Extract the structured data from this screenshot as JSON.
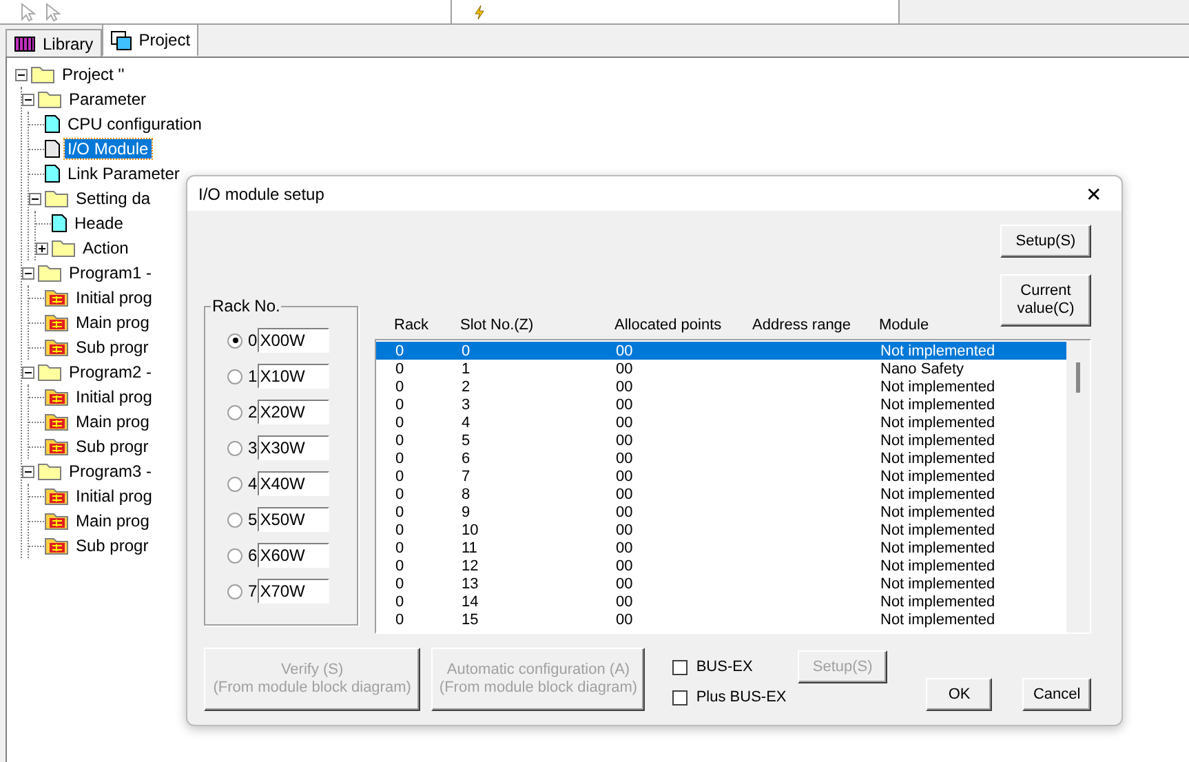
{
  "panel_tabs": [
    {
      "label": "Library",
      "selected": false
    },
    {
      "label": "Project",
      "selected": true
    }
  ],
  "tree": [
    {
      "label": "Project ''",
      "kind": "folder",
      "expanded": true,
      "selected": false,
      "children": [
        {
          "label": "Parameter",
          "kind": "folder",
          "expanded": true,
          "selected": false,
          "children": [
            {
              "label": "CPU configuration",
              "kind": "document",
              "selected": false
            },
            {
              "label": "I/O Module",
              "kind": "document",
              "selected": true
            },
            {
              "label": "Link Parameter",
              "kind": "document",
              "selected": false
            },
            {
              "label": "Setting da",
              "kind": "folder",
              "expanded": true,
              "selected": false,
              "children": [
                {
                  "label": "Heade",
                  "kind": "document",
                  "selected": false
                },
                {
                  "label": "Action",
                  "kind": "folder",
                  "expanded": false,
                  "selected": false
                }
              ]
            }
          ]
        },
        {
          "label": "Program1 -",
          "kind": "folder",
          "expanded": true,
          "selected": false,
          "children": [
            {
              "label": "Initial prog",
              "kind": "program",
              "selected": false
            },
            {
              "label": "Main prog",
              "kind": "program",
              "selected": false
            },
            {
              "label": "Sub progr",
              "kind": "program",
              "selected": false
            }
          ]
        },
        {
          "label": "Program2 -",
          "kind": "folder",
          "expanded": true,
          "selected": false,
          "children": [
            {
              "label": "Initial prog",
              "kind": "program",
              "selected": false
            },
            {
              "label": "Main prog",
              "kind": "program",
              "selected": false
            },
            {
              "label": "Sub progr",
              "kind": "program",
              "selected": false
            }
          ]
        },
        {
          "label": "Program3 -",
          "kind": "folder",
          "expanded": true,
          "selected": false,
          "children": [
            {
              "label": "Initial prog",
              "kind": "program",
              "selected": false
            },
            {
              "label": "Main prog",
              "kind": "program",
              "selected": false
            },
            {
              "label": "Sub progr",
              "kind": "program",
              "selected": false
            }
          ]
        }
      ]
    }
  ],
  "dialog": {
    "title": "I/O module setup",
    "close": "✕",
    "setup_button": {
      "label": "Setup(S)",
      "disabled": false
    },
    "current_value_button": {
      "label": "Current value(C)",
      "disabled": false
    },
    "rack_group": {
      "title": "Rack No.",
      "racks": [
        {
          "number": "0",
          "value": "X00W",
          "selected": true
        },
        {
          "number": "1",
          "value": "X10W",
          "selected": false
        },
        {
          "number": "2",
          "value": "X20W",
          "selected": false
        },
        {
          "number": "3",
          "value": "X30W",
          "selected": false
        },
        {
          "number": "4",
          "value": "X40W",
          "selected": false
        },
        {
          "number": "5",
          "value": "X50W",
          "selected": false
        },
        {
          "number": "6",
          "value": "X60W",
          "selected": false
        },
        {
          "number": "7",
          "value": "X70W",
          "selected": false
        }
      ]
    },
    "table": {
      "columns": [
        "Rack",
        "Slot No.(Z)",
        "Allocated points",
        "Address range",
        "Module"
      ],
      "rows": [
        {
          "cells": [
            "0",
            "0",
            "00",
            "",
            "Not implemented"
          ],
          "selected": true
        },
        {
          "cells": [
            "0",
            "1",
            "00",
            "",
            "Nano Safety"
          ],
          "selected": false
        },
        {
          "cells": [
            "0",
            "2",
            "00",
            "",
            "Not implemented"
          ],
          "selected": false
        },
        {
          "cells": [
            "0",
            "3",
            "00",
            "",
            "Not implemented"
          ],
          "selected": false
        },
        {
          "cells": [
            "0",
            "4",
            "00",
            "",
            "Not implemented"
          ],
          "selected": false
        },
        {
          "cells": [
            "0",
            "5",
            "00",
            "",
            "Not implemented"
          ],
          "selected": false
        },
        {
          "cells": [
            "0",
            "6",
            "00",
            "",
            "Not implemented"
          ],
          "selected": false
        },
        {
          "cells": [
            "0",
            "7",
            "00",
            "",
            "Not implemented"
          ],
          "selected": false
        },
        {
          "cells": [
            "0",
            "8",
            "00",
            "",
            "Not implemented"
          ],
          "selected": false
        },
        {
          "cells": [
            "0",
            "9",
            "00",
            "",
            "Not implemented"
          ],
          "selected": false
        },
        {
          "cells": [
            "0",
            "10",
            "00",
            "",
            "Not implemented"
          ],
          "selected": false
        },
        {
          "cells": [
            "0",
            "11",
            "00",
            "",
            "Not implemented"
          ],
          "selected": false
        },
        {
          "cells": [
            "0",
            "12",
            "00",
            "",
            "Not implemented"
          ],
          "selected": false
        },
        {
          "cells": [
            "0",
            "13",
            "00",
            "",
            "Not implemented"
          ],
          "selected": false
        },
        {
          "cells": [
            "0",
            "14",
            "00",
            "",
            "Not implemented"
          ],
          "selected": false
        },
        {
          "cells": [
            "0",
            "15",
            "00",
            "",
            "Not implemented"
          ],
          "selected": false
        }
      ]
    },
    "verify_button": {
      "lines": [
        "Verify (S)",
        "(From module block diagram)"
      ],
      "disabled": true
    },
    "auto_config_button": {
      "lines": [
        "Automatic configuration (A)",
        "(From module block diagram)"
      ],
      "disabled": true
    },
    "checkboxes": [
      {
        "label": "BUS-EX",
        "checked": false
      },
      {
        "label": "Plus BUS-EX",
        "checked": false
      }
    ],
    "bus_setup_button": {
      "label": "Setup(S)",
      "disabled": true
    },
    "ok_button": {
      "label": "OK",
      "disabled": false
    },
    "cancel_button": {
      "label": "Cancel",
      "disabled": false
    }
  }
}
